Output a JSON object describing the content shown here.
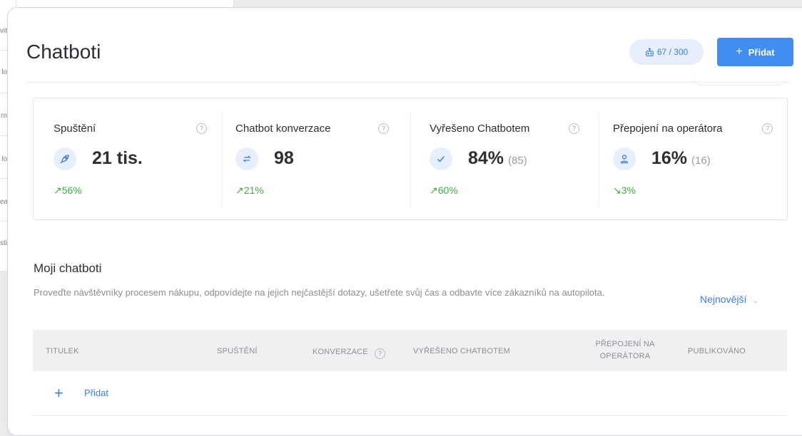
{
  "background": {
    "sidebar_fragments": [
      "vit",
      "lo",
      "ro",
      "lo",
      "ea",
      "sti"
    ]
  },
  "header": {
    "title": "Chatboti",
    "quota": "67 / 300",
    "add_label": "Přidat"
  },
  "stats": [
    {
      "title": "Spuštění",
      "value": "21 tis.",
      "sub": "",
      "trend": "↗56%",
      "trend_dir": "up",
      "icon": "rocket-icon"
    },
    {
      "title": "Chatbot konverzace",
      "value": "98",
      "sub": "",
      "trend": "↗21%",
      "trend_dir": "up",
      "icon": "arrows-exchange-icon"
    },
    {
      "title": "Vyřešeno Chatbotem",
      "value": "84%",
      "sub": "(85)",
      "trend": "↗60%",
      "trend_dir": "up",
      "icon": "check-icon"
    },
    {
      "title": "Přepojení na operátora",
      "value": "16%",
      "sub": "(16)",
      "trend": "↘3%",
      "trend_dir": "down",
      "icon": "user-icon"
    }
  ],
  "my_chatbots": {
    "title": "Moji chatboti",
    "description": "Proveďte návštěvníky procesem nákupu, odpovídejte na jejich nejčastější dotazy, ušetřete svůj čas a odbavte více zákazníků na autopilota.",
    "sort_label": "Nejnovější",
    "columns": [
      "TITULEK",
      "SPUŠTĚNÍ",
      "KONVERZACE",
      "VYŘEŠENO CHATBOTEM",
      "PŘEPOJENÍ NA OPERÁTORA",
      "PUBLIKOVÁNO"
    ],
    "add_row_label": "Přidat"
  },
  "colors": {
    "accent": "#3f8ef0",
    "positive": "#3fae3f",
    "icon_bg": "#e6effb"
  }
}
